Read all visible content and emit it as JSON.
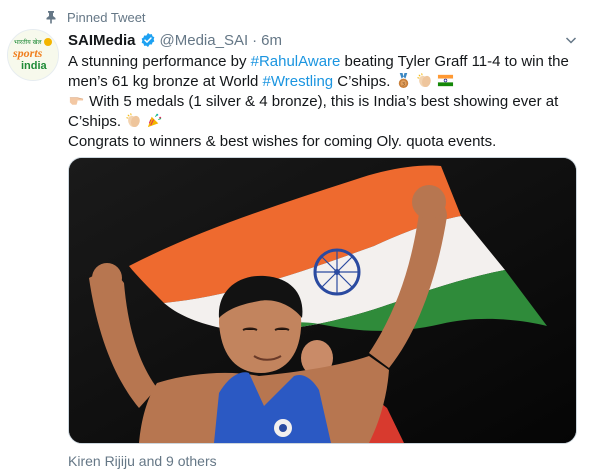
{
  "pinned_label": "Pinned Tweet",
  "author": {
    "name": "SAIMedia",
    "handle": "@Media_SAI",
    "separator": "·",
    "time": "6m",
    "avatar_label": "sports authority of india"
  },
  "tweet": {
    "p1_before": "A stunning performance by ",
    "p1_tag1": "#RahulAware",
    "p1_mid": " beating Tyler Graff 11-4 to win the men’s 61 kg bronze at World ",
    "p1_tag2": "#Wrestling",
    "p1_after": " C’ships.",
    "p2": "With 5 medals (1 silver & 4 bronze), this is India’s best showing ever at C’ships.",
    "p3": "Congrats to winners & best wishes for coming Oly. quota events."
  },
  "media_alt": "Wrestler holding the Indian flag overhead",
  "likes_text": "Kiren Rijiju and 9 others",
  "colors": {
    "link": "#1b95e0",
    "secondary_text": "#657786",
    "verified": "#1da1f2"
  },
  "icons": [
    "pin-icon",
    "verified-icon",
    "chevron-down-icon",
    "medal-emoji",
    "clap-emoji",
    "flag-india-emoji",
    "point-right-emoji",
    "party-popper-emoji"
  ]
}
